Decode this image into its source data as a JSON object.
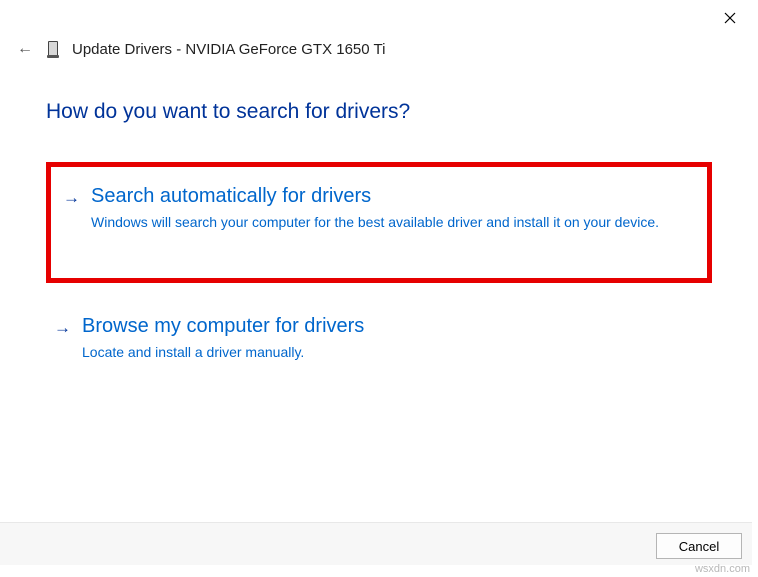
{
  "window": {
    "title": "Update Drivers - NVIDIA GeForce GTX 1650 Ti"
  },
  "question": "How do you want to search for drivers?",
  "options": {
    "auto": {
      "title": "Search automatically for drivers",
      "desc": "Windows will search your computer for the best available driver and install it on your device."
    },
    "browse": {
      "title": "Browse my computer for drivers",
      "desc": "Locate and install a driver manually."
    }
  },
  "footer": {
    "cancel": "Cancel"
  },
  "watermark": "wsxdn.com"
}
